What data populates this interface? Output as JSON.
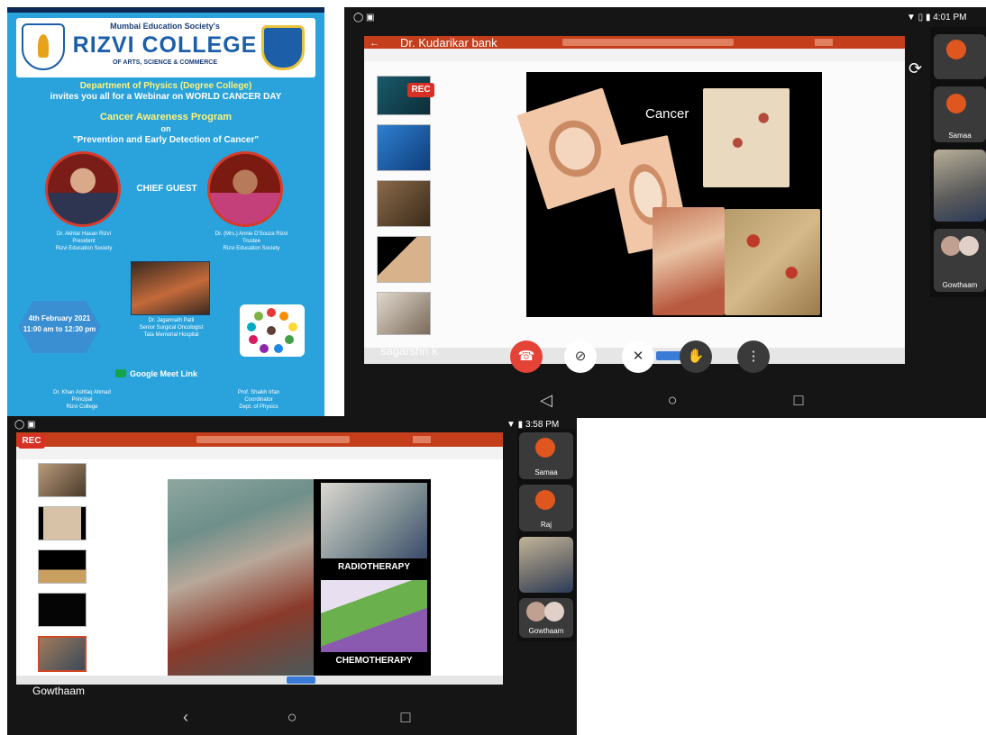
{
  "poster": {
    "pre_title": "Mumbai Education Society's",
    "college": "RIZVI COLLEGE",
    "college_sub": "OF ARTS, SCIENCE & COMMERCE",
    "department_line": "Department of Physics (Degree College)",
    "invite_line": "invites you all for a Webinar on WORLD CANCER DAY",
    "program_title": "Cancer Awareness Program",
    "on_word": "on",
    "topic": "\"Prevention and Early Detection of Cancer\"",
    "chief_guest_label": "CHIEF GUEST",
    "chief_caption": "Dr. Akhtar Hasan Rizvi\nPresident\nRizvi Education Society",
    "guest_caption": "Dr. (Mrs.) Annie D'Souza Rizvi\nTrustee\nRizvi Education Society",
    "speaker_caption": "Dr. Jagannath Patil\nSenior Surgical Oncologist\nTata Memorial Hospital",
    "date_text": "4th February 2021\n11:00 am to 12:30 pm",
    "meet_label": "Google Meet Link",
    "footer_left": "Dr. Khan Ashfaq Ahmad\nPrincipal\nRizvi College",
    "footer_right": "Prof. Shaikh Irfan\nCoordinator\nDept. of Physics"
  },
  "tablet1": {
    "status_time": "4:01 PM",
    "rec_label": "REC",
    "presenter_name": "Dr. Kudarikar bank",
    "slide_title": "Cancer",
    "bottom_name": "sagarshri k",
    "side_tiles": [
      "Samaa",
      "Gowthaam"
    ],
    "controls": [
      "end-call",
      "camera-off",
      "mic-off",
      "raise-hand",
      "more"
    ]
  },
  "tablet2": {
    "status_time": "3:58 PM",
    "rec_label": "REC",
    "slide_labels": [
      "RADIOTHERAPY",
      "CHEMOTHERAPY"
    ],
    "side_tiles": [
      "Samaa",
      "Raj",
      "Gowthaam"
    ],
    "bottom_name": "Gowthaam"
  },
  "colors": {
    "poster_bg": "#2aa3dc",
    "college_blue": "#1c5fa8",
    "ppt_ribbon": "#c43e1c",
    "end_call": "#e54338",
    "rec": "#d93025"
  }
}
